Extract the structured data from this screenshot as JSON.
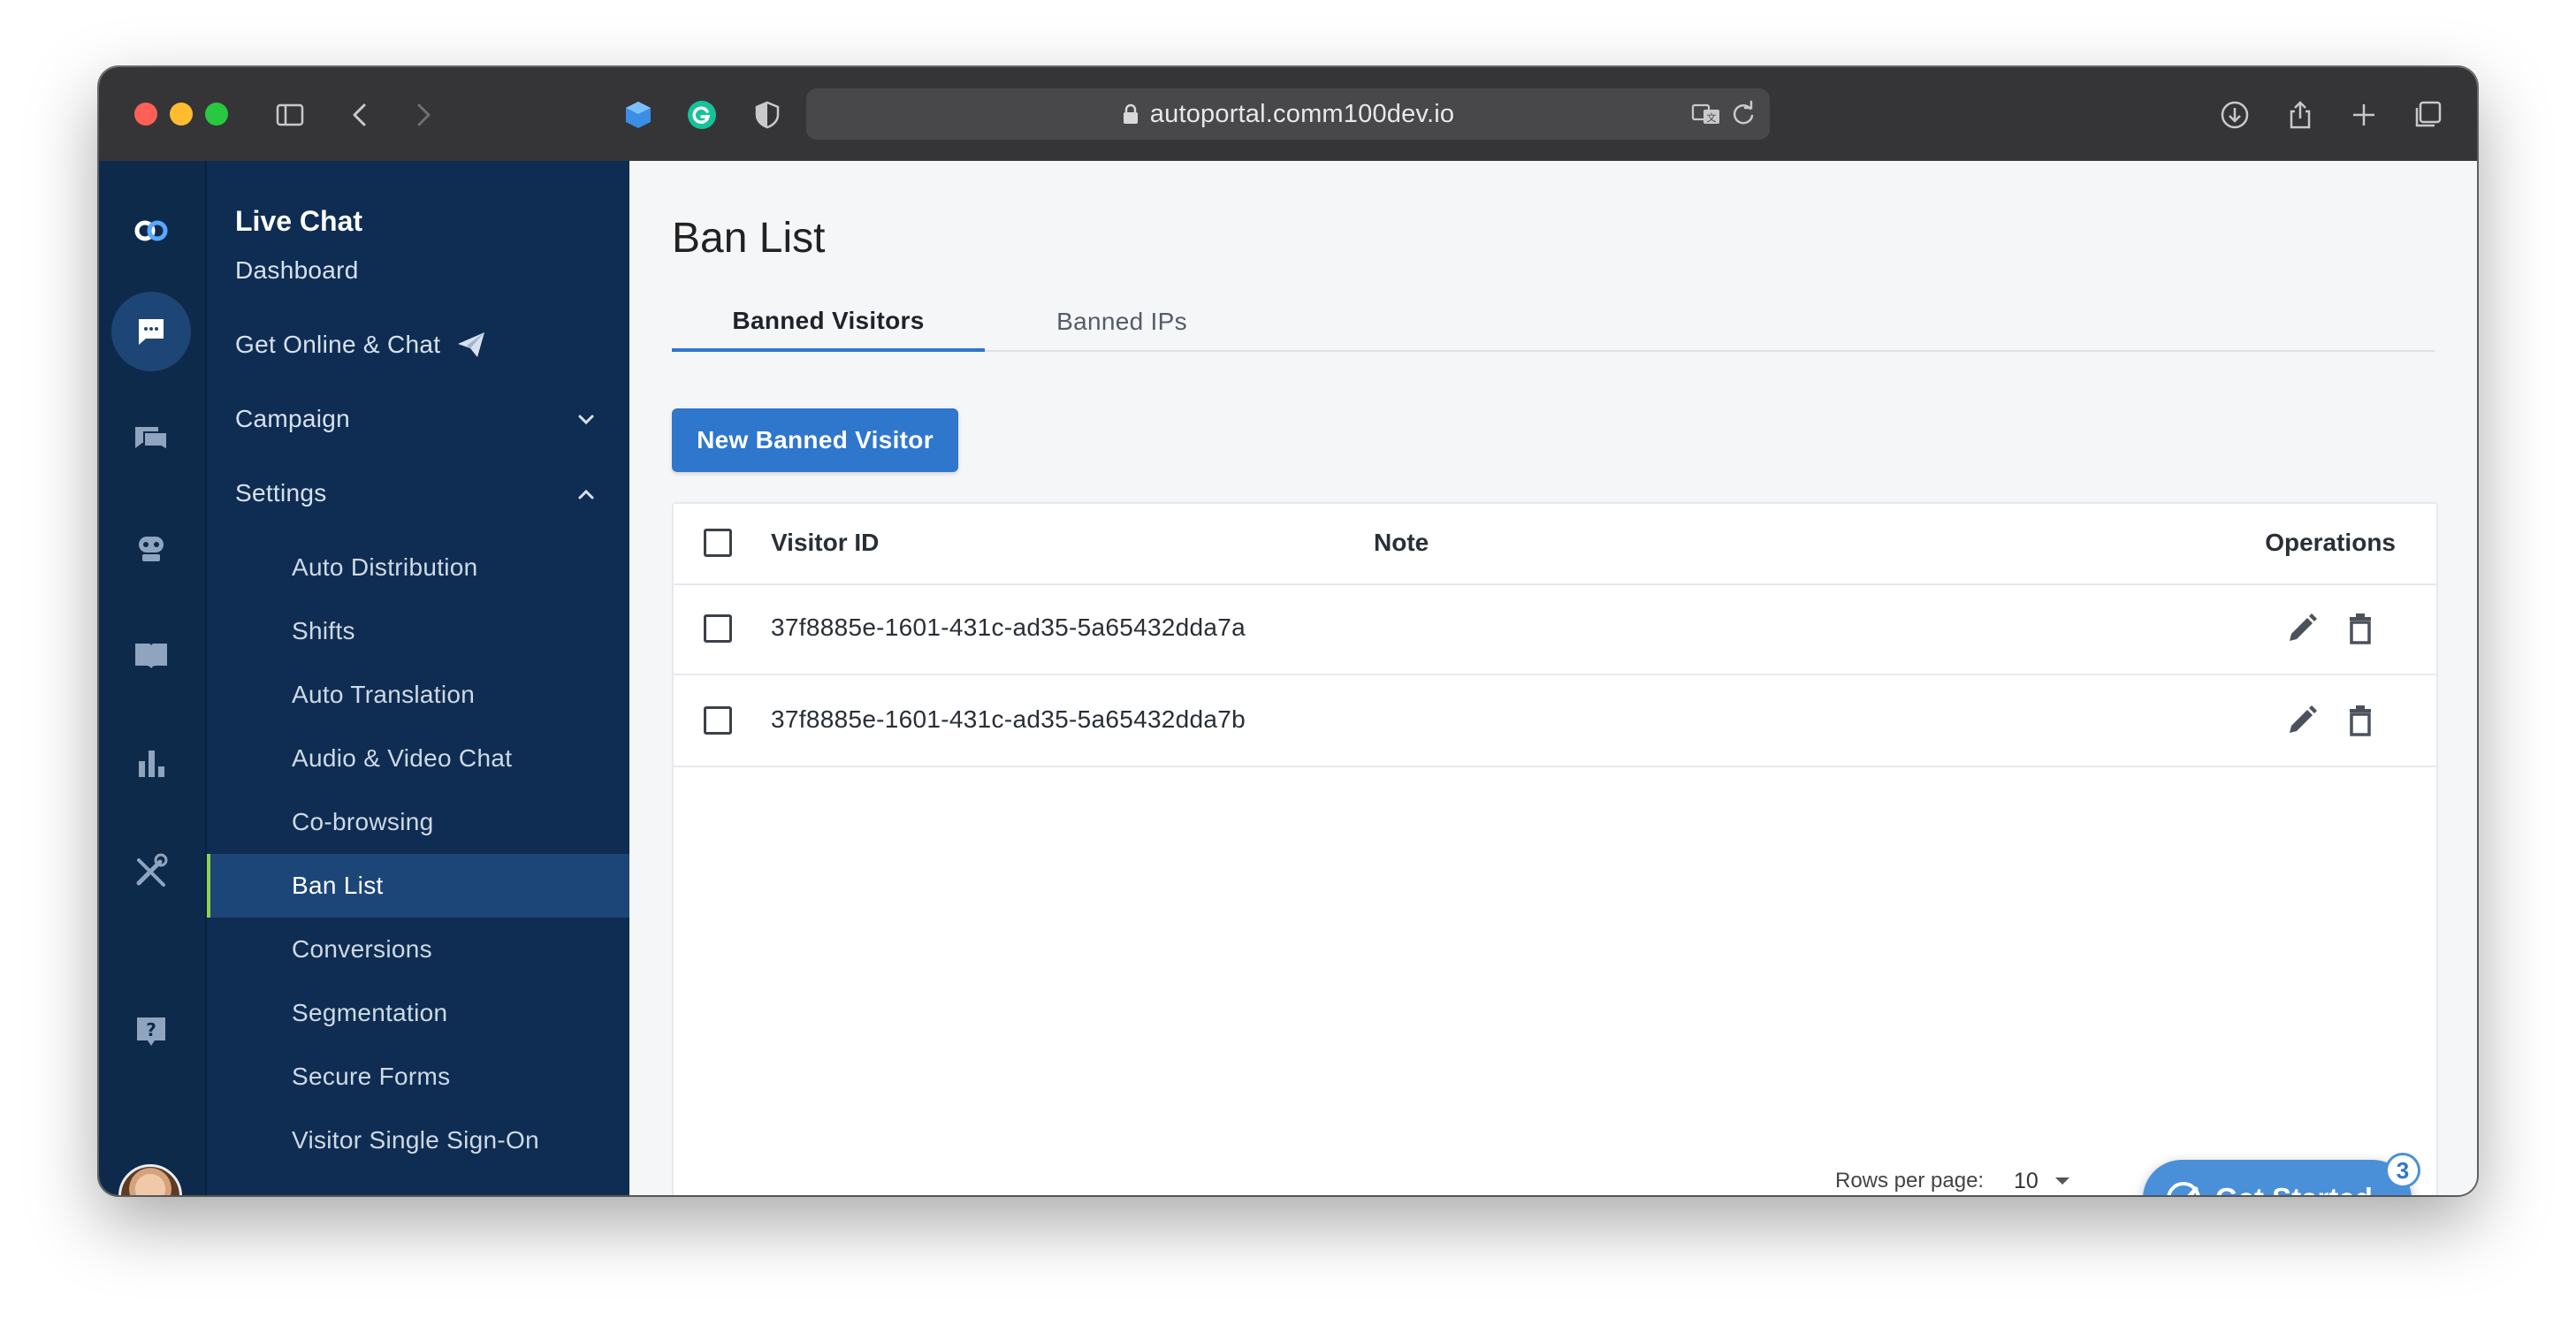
{
  "browser": {
    "url": "autoportal.comm100dev.io"
  },
  "nav": {
    "title": "Live Chat",
    "items": [
      {
        "label": "Dashboard"
      },
      {
        "label": "Get Online & Chat"
      },
      {
        "label": "Campaign"
      },
      {
        "label": "Settings"
      }
    ],
    "settings_items": [
      {
        "label": "Auto Distribution"
      },
      {
        "label": "Shifts"
      },
      {
        "label": "Auto Translation"
      },
      {
        "label": "Audio & Video Chat"
      },
      {
        "label": "Co-browsing"
      },
      {
        "label": "Ban List"
      },
      {
        "label": "Conversions"
      },
      {
        "label": "Segmentation"
      },
      {
        "label": "Secure Forms"
      },
      {
        "label": "Visitor Single Sign-On"
      }
    ]
  },
  "rail": {
    "icons": [
      "logo-icon",
      "chat-icon",
      "messages-icon",
      "bot-icon",
      "knowledge-base-icon",
      "reports-icon",
      "tools-icon",
      "help-icon"
    ]
  },
  "main": {
    "title": "Ban List",
    "tabs": [
      {
        "label": "Banned Visitors",
        "active": true
      },
      {
        "label": "Banned IPs",
        "active": false
      }
    ],
    "new_button_label": "New Banned Visitor",
    "table": {
      "columns": [
        "Visitor ID",
        "Note",
        "Operations"
      ],
      "rows": [
        {
          "visitor_id": "37f8885e-1601-431c-ad35-5a65432dda7a",
          "note": ""
        },
        {
          "visitor_id": "37f8885e-1601-431c-ad35-5a65432dda7b",
          "note": ""
        }
      ]
    },
    "pagination": {
      "rows_per_page_label": "Rows per page:",
      "rows_per_page_value": "10"
    }
  },
  "get_started": {
    "label": "Get Started",
    "badge": "3"
  },
  "colors": {
    "primary": "#2f76cd",
    "sidebar": "#0f2d52",
    "rail": "#0e2a4b",
    "active_indicator": "#8fd14f"
  }
}
